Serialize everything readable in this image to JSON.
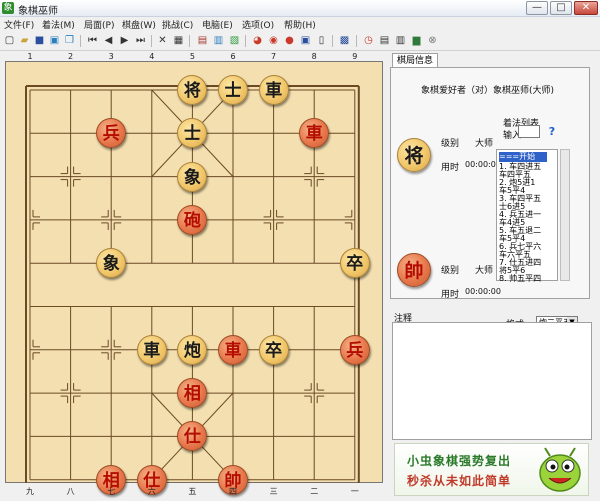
{
  "window": {
    "title": "象棋巫师",
    "minimize": "—",
    "restore": "□",
    "close": "✕"
  },
  "menu": [
    "文件(F)",
    "着法(M)",
    "局面(P)",
    "棋盘(W)",
    "挑战(C)",
    "电脑(E)",
    "选项(O)",
    "帮助(H)"
  ],
  "toolbar_icons": [
    "new-file-icon",
    "open-file-icon",
    "save-icon",
    "print-icon",
    "copy-icon",
    "first-move-icon",
    "prev-move-icon",
    "next-move-icon",
    "last-move-icon",
    "delete-icon",
    "edit-board-icon",
    "book-icon",
    "stats-icon",
    "color-icon",
    "think-icon",
    "eye-icon",
    "analyze-icon",
    "hint-icon",
    "pause-icon",
    "clock-icon",
    "library-icon",
    "report-icon",
    "settings-icon",
    "stop-icon"
  ],
  "board": {
    "top_coords": [
      "1",
      "2",
      "3",
      "4",
      "5",
      "6",
      "7",
      "8",
      "9"
    ],
    "bottom_coords": [
      "九",
      "八",
      "七",
      "六",
      "五",
      "四",
      "三",
      "二",
      "一"
    ],
    "pieces": [
      {
        "char": "将",
        "side": "black",
        "file": 4,
        "rank": 0
      },
      {
        "char": "士",
        "side": "black",
        "file": 5,
        "rank": 0
      },
      {
        "char": "車",
        "side": "black",
        "file": 6,
        "rank": 0
      },
      {
        "char": "兵",
        "side": "red",
        "file": 2,
        "rank": 1
      },
      {
        "char": "士",
        "side": "black",
        "file": 4,
        "rank": 1
      },
      {
        "char": "車",
        "side": "red",
        "file": 7,
        "rank": 1
      },
      {
        "char": "象",
        "side": "black",
        "file": 4,
        "rank": 2
      },
      {
        "char": "砲",
        "side": "red",
        "file": 4,
        "rank": 3
      },
      {
        "char": "象",
        "side": "black",
        "file": 2,
        "rank": 4
      },
      {
        "char": "卒",
        "side": "black",
        "file": 8,
        "rank": 4
      },
      {
        "char": "車",
        "side": "black",
        "file": 3,
        "rank": 6
      },
      {
        "char": "炮",
        "side": "black",
        "file": 4,
        "rank": 6
      },
      {
        "char": "車",
        "side": "red",
        "file": 5,
        "rank": 6
      },
      {
        "char": "卒",
        "side": "black",
        "file": 6,
        "rank": 6
      },
      {
        "char": "兵",
        "side": "red",
        "file": 8,
        "rank": 6
      },
      {
        "char": "相",
        "side": "red",
        "file": 4,
        "rank": 7
      },
      {
        "char": "仕",
        "side": "red",
        "file": 4,
        "rank": 8
      },
      {
        "char": "相",
        "side": "red",
        "file": 2,
        "rank": 9
      },
      {
        "char": "仕",
        "side": "red",
        "file": 3,
        "rank": 9
      },
      {
        "char": "帥",
        "side": "red",
        "file": 5,
        "rank": 9
      }
    ]
  },
  "panel": {
    "tab_label": "棋局信息",
    "matchup": "象棋爱好者（对）象棋巫师(大师)",
    "notation_title": "着法列表",
    "input_label": "输入",
    "help_glyph": "?",
    "black_player": {
      "avatar": "将",
      "level_label": "级别",
      "level": "大师",
      "time_label": "用时",
      "time": "00:00:00"
    },
    "red_player": {
      "avatar": "帥",
      "level_label": "级别",
      "level": "大师",
      "time_label": "用时",
      "time": "00:00:00"
    },
    "moves": [
      "===开始===",
      "1. 车四进五",
      "   车四平五",
      "2. 炮5进1",
      "   车5平4",
      "3. 车四平五",
      "   士6进5",
      "4. 兵五进一",
      "   车4进5",
      "5. 车五退二",
      "   车5平4",
      "6. 兵七平六",
      "   车六平五",
      "7. 仕五进四",
      "   将5平6",
      "8. 帅五平四",
      "   兵七平六"
    ],
    "format_label": "格式",
    "format_value": "炮二平五",
    "notes_label": "注释"
  },
  "ad": {
    "line1": "小虫象棋强势复出",
    "line2": "秒杀从未如此简单"
  }
}
